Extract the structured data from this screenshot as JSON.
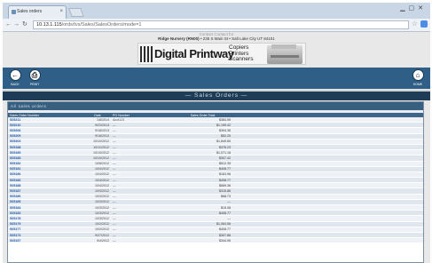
{
  "browser": {
    "tab_title": "Sales orders",
    "tab_close": "×",
    "address": "10.13.1.115",
    "address_path": "/ords/tvs/Sales/SalesOrders/mode=1"
  },
  "header": {
    "contact_line": "Contact Contact for",
    "company_name": "Ridge Nursery (RN00)",
    "company_address": "• 235 S Main St • Salt Lake City UT 84101",
    "banner_brand": "Digital Printway",
    "banner_tagline": [
      "Copiers",
      "Printers",
      "Scanners"
    ]
  },
  "toolbar": {
    "back_label": "Back",
    "print_label": "Print",
    "home_label": "Home"
  },
  "page_title": "— Sales Orders —",
  "section_title": "All sales orders",
  "table": {
    "columns": [
      "Sales Order Number",
      "Date",
      "PO Number",
      "Sales Order Total",
      ""
    ],
    "rows": [
      {
        "so": "S05211",
        "date": "1/8/2014",
        "po": "Acct123",
        "total": "$384.95"
      },
      {
        "so": "S05210",
        "date": "9/23/2013",
        "po": "—",
        "total": "$1,199.42"
      },
      {
        "so": "S05206",
        "date": "9/18/2013",
        "po": "—",
        "total": "$394.36"
      },
      {
        "so": "S05209",
        "date": "9/18/2013",
        "po": "—",
        "total": "$52.25"
      },
      {
        "so": "S05203",
        "date": "10/10/2012",
        "po": "—",
        "total": "$1,849.65"
      },
      {
        "so": "S05188",
        "date": "10/11/2012",
        "po": "—",
        "total": "$376.23"
      },
      {
        "so": "S05189",
        "date": "10/10/2012",
        "po": "—",
        "total": "$1,071.18"
      },
      {
        "so": "S05185",
        "date": "10/10/2012",
        "po": "—",
        "total": "$307.42"
      },
      {
        "so": "S05182",
        "date": "10/8/2012",
        "po": "—",
        "total": "$512.35"
      },
      {
        "so": "S05181",
        "date": "10/4/2012",
        "po": "—",
        "total": "$408.77"
      },
      {
        "so": "S05186",
        "date": "10/4/2012",
        "po": "—",
        "total": "$163.96"
      },
      {
        "so": "S05180",
        "date": "10/4/2012",
        "po": "—",
        "total": "$408.77"
      },
      {
        "so": "S05188",
        "date": "10/4/2012",
        "po": "—",
        "total": "$669.36"
      },
      {
        "so": "S05187",
        "date": "10/3/2012",
        "po": "—",
        "total": "$315.86"
      },
      {
        "so": "S05186",
        "date": "10/3/2012",
        "po": "—",
        "total": "$88.73"
      },
      {
        "so": "S05185",
        "date": "10/3/2012",
        "po": "—",
        "total": "—"
      },
      {
        "so": "S05184",
        "date": "10/3/2012",
        "po": "—",
        "total": "$15.08"
      },
      {
        "so": "S05183",
        "date": "10/3/2012",
        "po": "—",
        "total": "$408.77"
      },
      {
        "so": "S05178",
        "date": "10/3/2012",
        "po": "—",
        "total": "—"
      },
      {
        "so": "S05179",
        "date": "10/2/2012",
        "po": "—",
        "total": "$1,063.56"
      },
      {
        "so": "S05177",
        "date": "10/2/2012",
        "po": "—",
        "total": "$408.77"
      },
      {
        "so": "S05173",
        "date": "9/27/2012",
        "po": "—",
        "total": "$307.86"
      },
      {
        "so": "S05157",
        "date": "9/4/2012",
        "po": "—",
        "total": "$344.95"
      }
    ]
  }
}
